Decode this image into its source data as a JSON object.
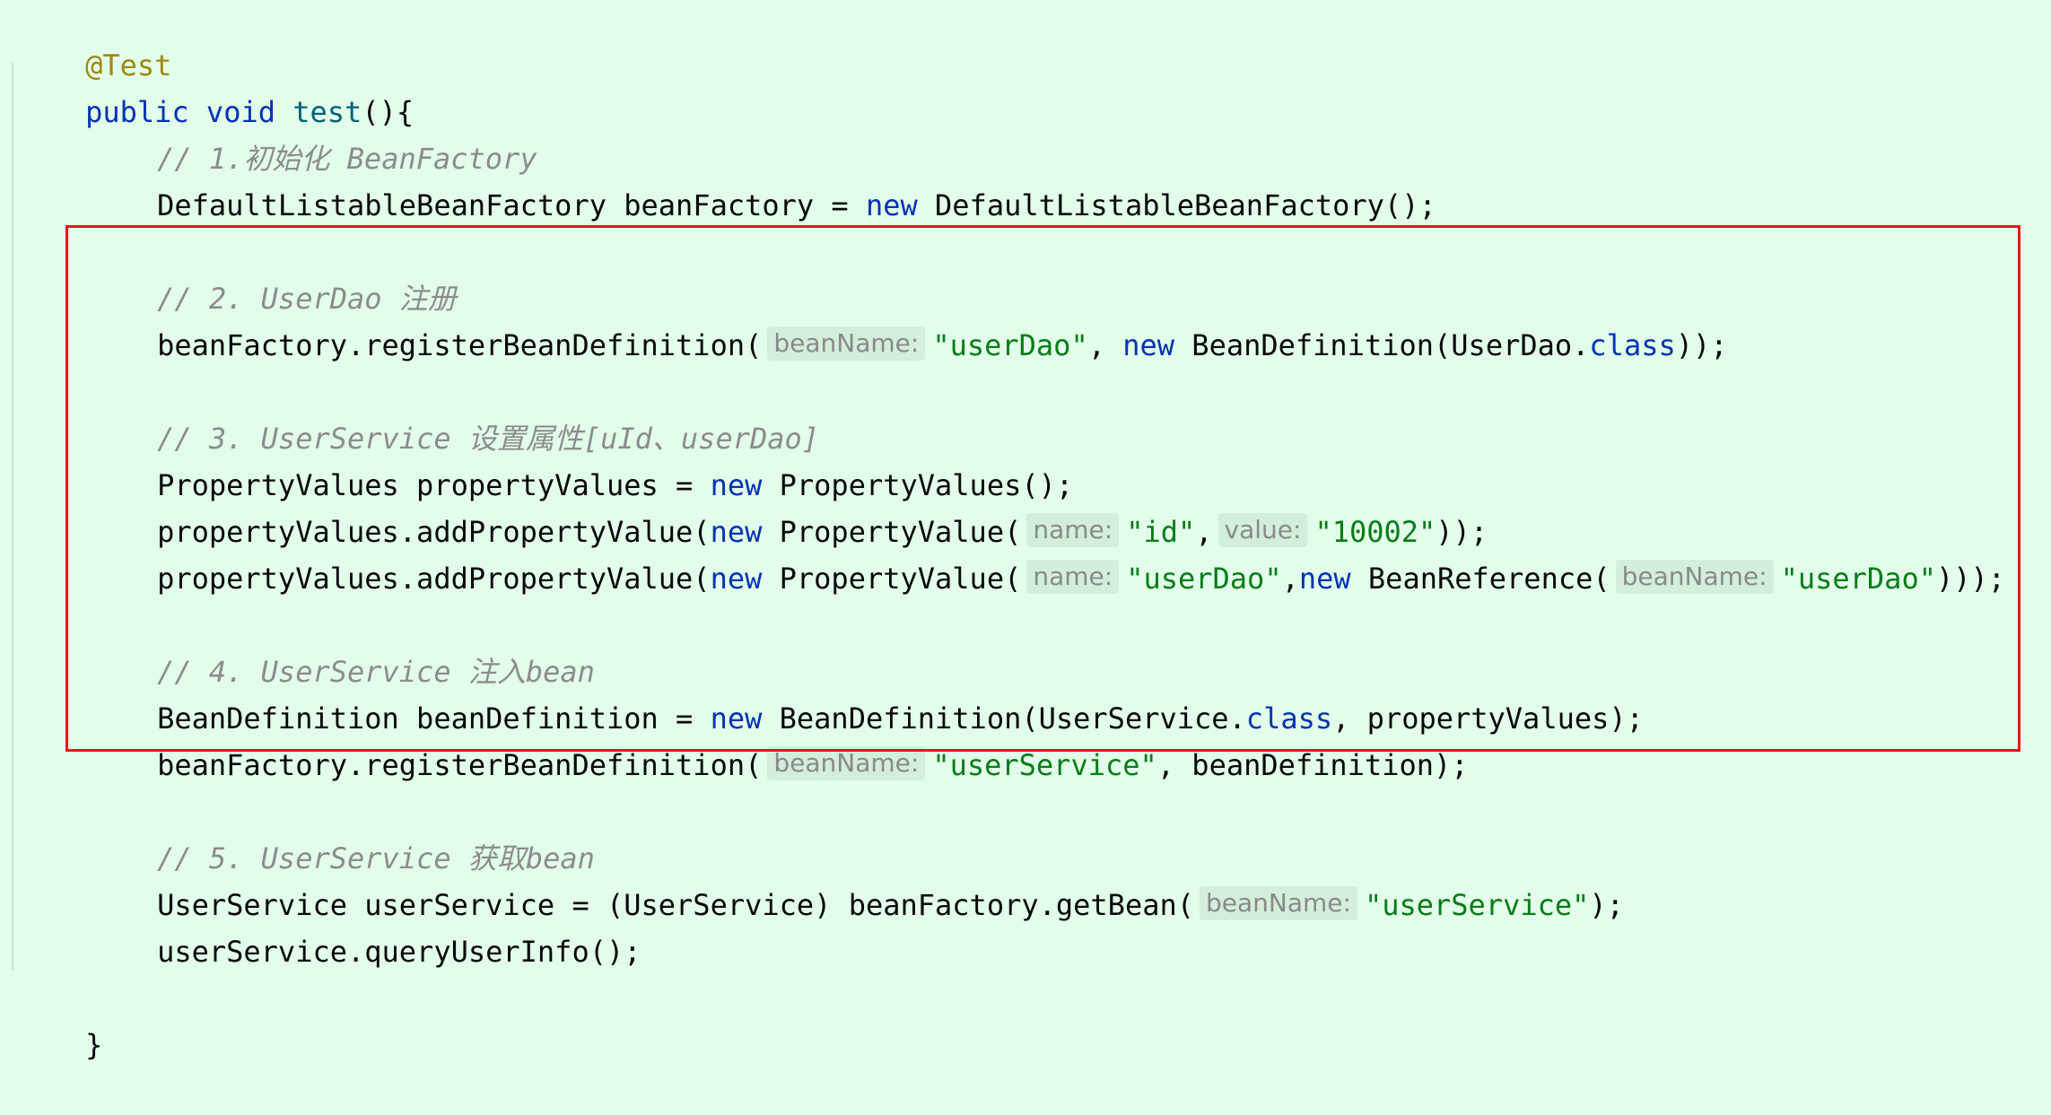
{
  "code": {
    "annotation": "@Test",
    "signature": {
      "kw_public": "public",
      "kw_void": "void",
      "method": "test",
      "tail": "(){"
    },
    "comment1": "// 1.初始化 BeanFactory",
    "line_factory": {
      "decl": "DefaultListableBeanFactory beanFactory = ",
      "kw_new": "new",
      "ctor": " DefaultListableBeanFactory();"
    },
    "comment2": "// 2. UserDao 注册",
    "line_register_dao": {
      "call": "beanFactory.registerBeanDefinition(",
      "hint": "beanName:",
      "str": "\"userDao\"",
      "sep": ", ",
      "kw_new": "new",
      "mid": " BeanDefinition(UserDao.",
      "kw_class": "class",
      "tail": "));"
    },
    "comment3": "// 3. UserService 设置属性[uId、userDao]",
    "line_pv_decl": {
      "decl": "PropertyValues propertyValues = ",
      "kw_new": "new",
      "ctor": " PropertyValues();"
    },
    "line_pv_add1": {
      "call": "propertyValues.addPropertyValue(",
      "kw_new": "new",
      "ctor": " PropertyValue(",
      "hint_name": "name:",
      "str_name": "\"id\"",
      "sep": ",",
      "hint_value": "value:",
      "str_value": "\"10002\"",
      "tail": "));"
    },
    "line_pv_add2": {
      "call": "propertyValues.addPropertyValue(",
      "kw_new": "new",
      "ctor": " PropertyValue(",
      "hint_name": "name:",
      "str_name": "\"userDao\"",
      "sep": ",",
      "kw_new2": "new",
      "ref": " BeanReference(",
      "hint_bean": "beanName:",
      "str_bean": "\"userDao\"",
      "tail": ")));"
    },
    "comment4": "// 4. UserService 注入bean",
    "line_bd_decl": {
      "decl": "BeanDefinition beanDefinition = ",
      "kw_new": "new",
      "mid": " BeanDefinition(UserService.",
      "kw_class": "class",
      "tail": ", propertyValues);"
    },
    "line_register_service": {
      "call": "beanFactory.registerBeanDefinition(",
      "hint": "beanName:",
      "str": "\"userService\"",
      "tail": ", beanDefinition);"
    },
    "comment5": "// 5. UserService 获取bean",
    "line_get_bean": {
      "decl": "UserService userService = (UserService) beanFactory.getBean(",
      "hint": "beanName:",
      "str": "\"userService\"",
      "tail": ");"
    },
    "line_query": "userService.queryUserInfo();",
    "closing_brace": "}"
  },
  "colors": {
    "background": "#e2fde9",
    "keyword": "#0033b3",
    "string": "#067d17",
    "comment": "#8c8c8c",
    "annotation": "#9e880d",
    "method": "#00627a",
    "highlight_border": "#e8141b"
  }
}
